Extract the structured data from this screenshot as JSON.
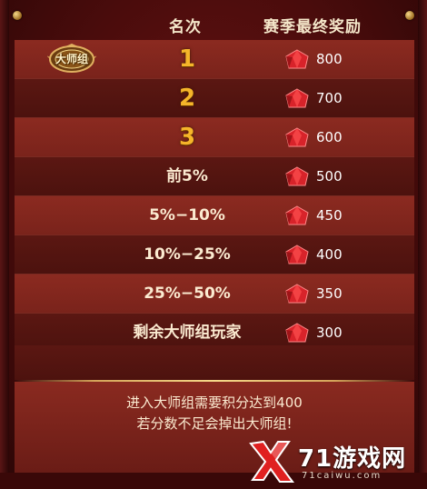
{
  "header": {
    "rank_col": "名次",
    "reward_col": "赛季最终奖励"
  },
  "rows": [
    {
      "rank": "1",
      "reward": "800"
    },
    {
      "rank": "2",
      "reward": "700"
    },
    {
      "rank": "3",
      "reward": "600"
    },
    {
      "rank": "前5%",
      "reward": "500"
    },
    {
      "rank": "5%−10%",
      "reward": "450"
    },
    {
      "rank": "10%−25%",
      "reward": "400"
    },
    {
      "rank": "25%−50%",
      "reward": "350"
    },
    {
      "rank": "剩余大师组玩家",
      "reward": "300"
    }
  ],
  "badge": {
    "label": "大师组",
    "icon": "master-league-badge-icon"
  },
  "reward_icon": "red-gem-icon",
  "notice": {
    "line1": "进入大师组需要积分达到400",
    "line2": "若分数不足会掉出大师组!"
  },
  "watermark": {
    "text": "71游戏网",
    "sub": "71caiwu.com"
  },
  "colors": {
    "gold_rank": "#f5b52a",
    "row_light": "#8b2a20",
    "row_dark": "#4c120e",
    "text_light": "#fbead0"
  }
}
